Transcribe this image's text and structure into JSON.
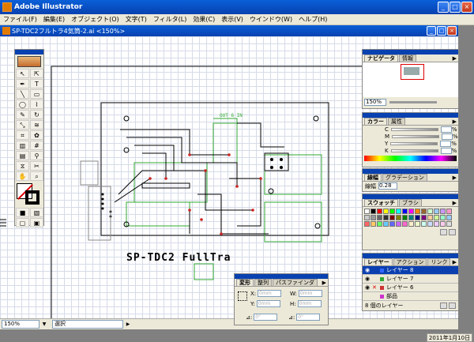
{
  "app": {
    "title": "Adobe Illustrator"
  },
  "menu": [
    "ファイル(F)",
    "編集(E)",
    "オブジェクト(O)",
    "文字(T)",
    "フィルタ(L)",
    "効果(C)",
    "表示(V)",
    "ウインドウ(W)",
    "ヘルプ(H)"
  ],
  "document": {
    "title": "SP-TDC2フルトラ4気筒-2.ai <150%>",
    "board_label": "SP-TDC2  FullTra",
    "trace_label": "OUT 6 IN",
    "zoom": "150%",
    "tool": "選択"
  },
  "navigator": {
    "tabs": [
      "ナビゲータ",
      "情報"
    ],
    "zoom": "150%"
  },
  "color": {
    "tabs": [
      "カラー",
      "属性"
    ],
    "channels": [
      "C",
      "M",
      "Y",
      "K"
    ],
    "unit": "%"
  },
  "stroke": {
    "tabs": [
      "線幅",
      "グラデーション"
    ],
    "label": "線幅",
    "value": "0.28"
  },
  "swatches": {
    "tabs": [
      "スウォッチ",
      "ブラシ"
    ],
    "colors": [
      "#ffffff",
      "#000000",
      "#ff0000",
      "#ffff00",
      "#00ff00",
      "#00ffff",
      "#0000ff",
      "#ff00ff",
      "#ff8800",
      "#996633",
      "#ccffcc",
      "#99ccff",
      "#cc99ff",
      "#ff99cc",
      "#cccccc",
      "#999999",
      "#666666",
      "#333333",
      "#800000",
      "#808000",
      "#008000",
      "#008080",
      "#000080",
      "#800080",
      "#ffcc99",
      "#ccff99",
      "#99ffcc",
      "#99ccff",
      "#ff6666",
      "#ffcc66",
      "#66ff66",
      "#66ccff",
      "#6666ff",
      "#cc66ff",
      "#ff66cc",
      "#ffeecc",
      "#eeffcc",
      "#ccffee",
      "#ccddff",
      "#eeccff",
      "#ffccee",
      "#dddddd"
    ]
  },
  "layers": {
    "tabs": [
      "レイヤー",
      "アクション",
      "リンク"
    ],
    "items": [
      {
        "name": "レイヤー 8",
        "color": "#3366ff",
        "selected": true
      },
      {
        "name": "レイヤー 7",
        "color": "#33aa33",
        "selected": false
      },
      {
        "name": "レイヤー 6",
        "color": "#cc3333",
        "selected": false
      },
      {
        "name": "部品",
        "color": "#cc33cc",
        "selected": false
      }
    ],
    "count": "8 個のレイヤー"
  },
  "transform": {
    "tabs": [
      "変形",
      "整列",
      "パスファインダ"
    ],
    "fields": {
      "x_label": "X:",
      "x": "0mm",
      "y_label": "Y:",
      "y": "0mm",
      "w_label": "W:",
      "w": "0mm",
      "h_label": "H:",
      "h": "0mm",
      "rot_label": "⊿:",
      "rot": "0°",
      "shear_label": "⊿:",
      "shear": "0°"
    }
  },
  "status": {
    "date": "2011年1月10日"
  }
}
